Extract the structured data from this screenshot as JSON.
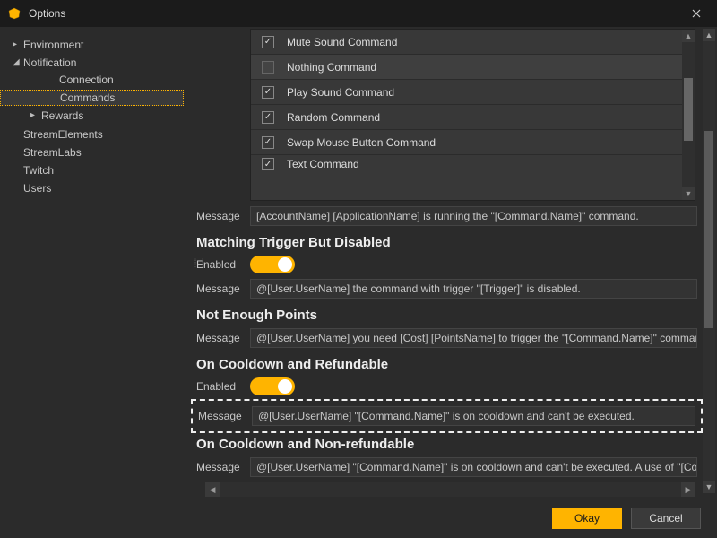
{
  "window": {
    "title": "Options"
  },
  "sidebar": {
    "items": [
      {
        "label": "Environment",
        "arrow": "▸"
      },
      {
        "label": "Notification",
        "arrow": "◢"
      },
      {
        "label": "StreamElements",
        "arrow": ""
      },
      {
        "label": "StreamLabs",
        "arrow": ""
      },
      {
        "label": "Twitch",
        "arrow": ""
      },
      {
        "label": "Users",
        "arrow": ""
      }
    ],
    "notification_children": [
      {
        "label": "Connection"
      },
      {
        "label": "Commands"
      },
      {
        "label": "Rewards",
        "arrow": "▸"
      }
    ]
  },
  "commands_list": [
    {
      "checked": true,
      "label": "Mute Sound Command"
    },
    {
      "checked": false,
      "label": "Nothing Command"
    },
    {
      "checked": true,
      "label": "Play Sound Command"
    },
    {
      "checked": true,
      "label": "Random Command"
    },
    {
      "checked": true,
      "label": "Swap Mouse Button Command"
    },
    {
      "checked": true,
      "label": "Text Command"
    }
  ],
  "labels": {
    "message": "Message",
    "enabled": "Enabled"
  },
  "sections": {
    "top_message": "[AccountName] [ApplicationName] is running the \"[Command.Name]\" command.",
    "matching_disabled": {
      "title": "Matching Trigger But Disabled",
      "enabled": true,
      "message": "@[User.UserName] the command with trigger \"[Trigger]\" is disabled."
    },
    "not_enough_points": {
      "title": "Not Enough Points",
      "message": "@[User.UserName] you need [Cost] [PointsName] to trigger the \"[Command.Name]\" command."
    },
    "cooldown_refundable": {
      "title": "On Cooldown and Refundable",
      "enabled": true,
      "message": "@[User.UserName] \"[Command.Name]\" is on cooldown and can't be executed."
    },
    "cooldown_nonrefundable": {
      "title": "On Cooldown and Non-refundable",
      "message": "@[User.UserName] \"[Command.Name]\" is on cooldown and can't be executed. A use of \"[Command.N"
    }
  },
  "footer": {
    "okay": "Okay",
    "cancel": "Cancel"
  },
  "colors": {
    "accent": "#FFB400"
  }
}
